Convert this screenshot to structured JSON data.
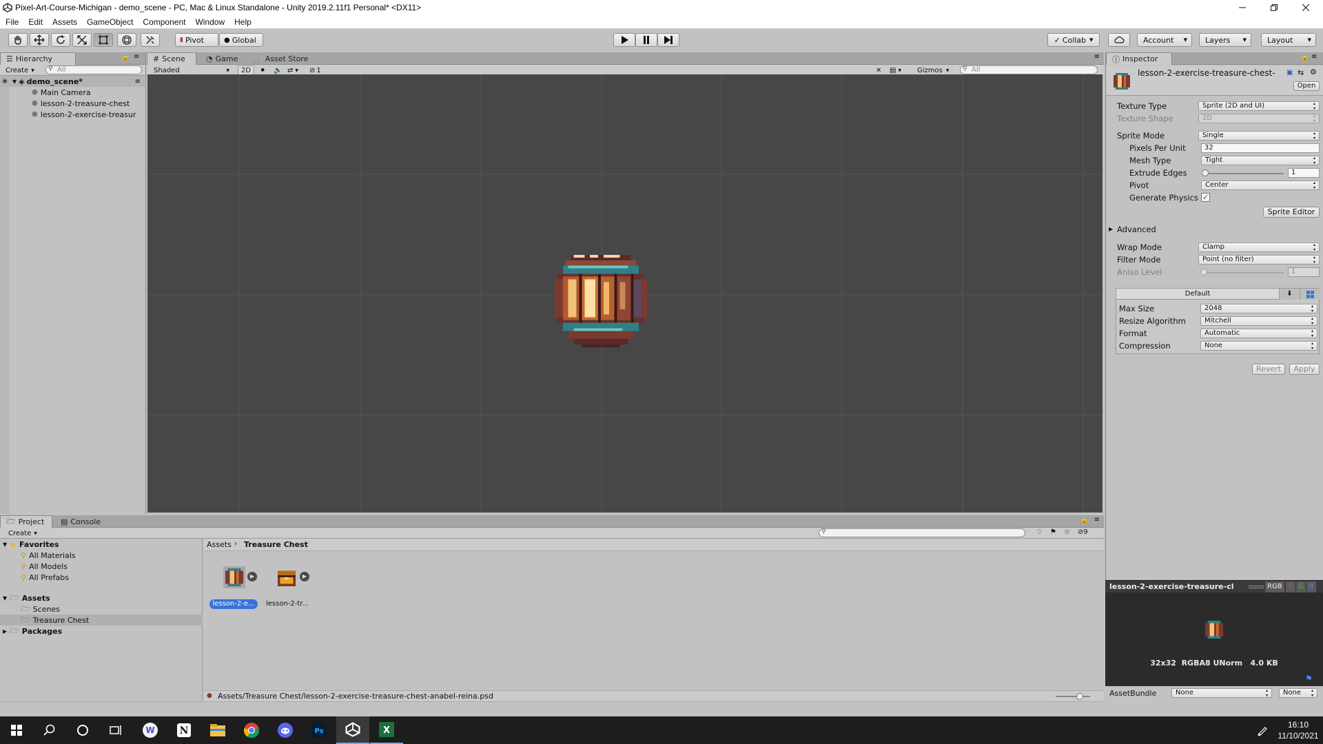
{
  "window": {
    "title": "Pixel-Art-Course-Michigan - demo_scene - PC, Mac & Linux Standalone - Unity 2019.2.11f1 Personal* <DX11>"
  },
  "menu": [
    "File",
    "Edit",
    "Assets",
    "GameObject",
    "Component",
    "Window",
    "Help"
  ],
  "toolbar": {
    "pivot": "Pivot",
    "global": "Global",
    "collab": "Collab",
    "account": "Account",
    "layers": "Layers",
    "layout": "Layout"
  },
  "hierarchy": {
    "tab": "Hierarchy",
    "create": "Create",
    "search_placeholder": "All",
    "scene": "demo_scene*",
    "items": [
      "Main Camera",
      "lesson-2-treasure-chest",
      "lesson-2-exercise-treasur"
    ]
  },
  "scene": {
    "tabs": [
      "Scene",
      "Game",
      "Asset Store"
    ],
    "shading": "Shaded",
    "mode2d": "2D",
    "hidden_count": "1",
    "gizmos": "Gizmos",
    "search_placeholder": "All"
  },
  "inspector": {
    "tab": "Inspector",
    "asset_name": "lesson-2-exercise-treasure-chest-",
    "open": "Open",
    "fields": {
      "texture_type": {
        "label": "Texture Type",
        "value": "Sprite (2D and UI)"
      },
      "texture_shape": {
        "label": "Texture Shape",
        "value": "2D"
      },
      "sprite_mode": {
        "label": "Sprite Mode",
        "value": "Single"
      },
      "pixels_per_unit": {
        "label": "Pixels Per Unit",
        "value": "32"
      },
      "mesh_type": {
        "label": "Mesh Type",
        "value": "Tight"
      },
      "extrude_edges": {
        "label": "Extrude Edges",
        "value": "1"
      },
      "pivot": {
        "label": "Pivot",
        "value": "Center"
      },
      "generate_physics": {
        "label": "Generate Physics",
        "checked": true
      }
    },
    "sprite_editor": "Sprite Editor",
    "advanced": "Advanced",
    "wrap_mode": {
      "label": "Wrap Mode",
      "value": "Clamp"
    },
    "filter_mode": {
      "label": "Filter Mode",
      "value": "Point (no filter)"
    },
    "aniso_level": {
      "label": "Aniso Level",
      "value": "1"
    },
    "platform": {
      "tab": "Default",
      "max_size": {
        "label": "Max Size",
        "value": "2048"
      },
      "resize_algorithm": {
        "label": "Resize Algorithm",
        "value": "Mitchell"
      },
      "format": {
        "label": "Format",
        "value": "Automatic"
      },
      "compression": {
        "label": "Compression",
        "value": "None"
      }
    },
    "revert": "Revert",
    "apply": "Apply"
  },
  "preview": {
    "title": "lesson-2-exercise-treasure-cl",
    "rgb": "RGB",
    "r": "R",
    "g": "G",
    "b": "B",
    "info": "32x32  RGBA8 UNorm   4.0 KB",
    "assetbundle_label": "AssetBundle",
    "assetbundle_value": "None",
    "variant_value": "None"
  },
  "project": {
    "tabs": [
      "Project",
      "Console"
    ],
    "create": "Create",
    "hidden_count": "9",
    "favorites": "Favorites",
    "favorite_items": [
      "All Materials",
      "All Models",
      "All Prefabs"
    ],
    "assets": "Assets",
    "asset_items": [
      "Scenes",
      "Treasure Chest"
    ],
    "packages": "Packages",
    "breadcrumb_root": "Assets",
    "breadcrumb_current": "Treasure Chest",
    "files": [
      "lesson-2-e...",
      "lesson-2-tr..."
    ],
    "footer_path": "Assets/Treasure Chest/lesson-2-exercise-treasure-chest-anabel-reina.psd"
  },
  "taskbar": {
    "time": "16:10",
    "date": "11/10/2021"
  },
  "colors": {
    "unity_gray": "#c2c2c2",
    "scene_bg": "#474747",
    "selection_blue": "#3a72d6",
    "taskbar": "#1d1d1d"
  },
  "icons": [
    "unity-logo-icon",
    "hand-tool-icon",
    "move-tool-icon",
    "rotate-tool-icon",
    "scale-tool-icon",
    "rect-tool-icon",
    "transform-tool-icon",
    "custom-tool-icon",
    "play-icon",
    "pause-icon",
    "step-icon",
    "cloud-icon",
    "folder-icon",
    "star-icon",
    "search-icon",
    "windows-start-icon"
  ]
}
